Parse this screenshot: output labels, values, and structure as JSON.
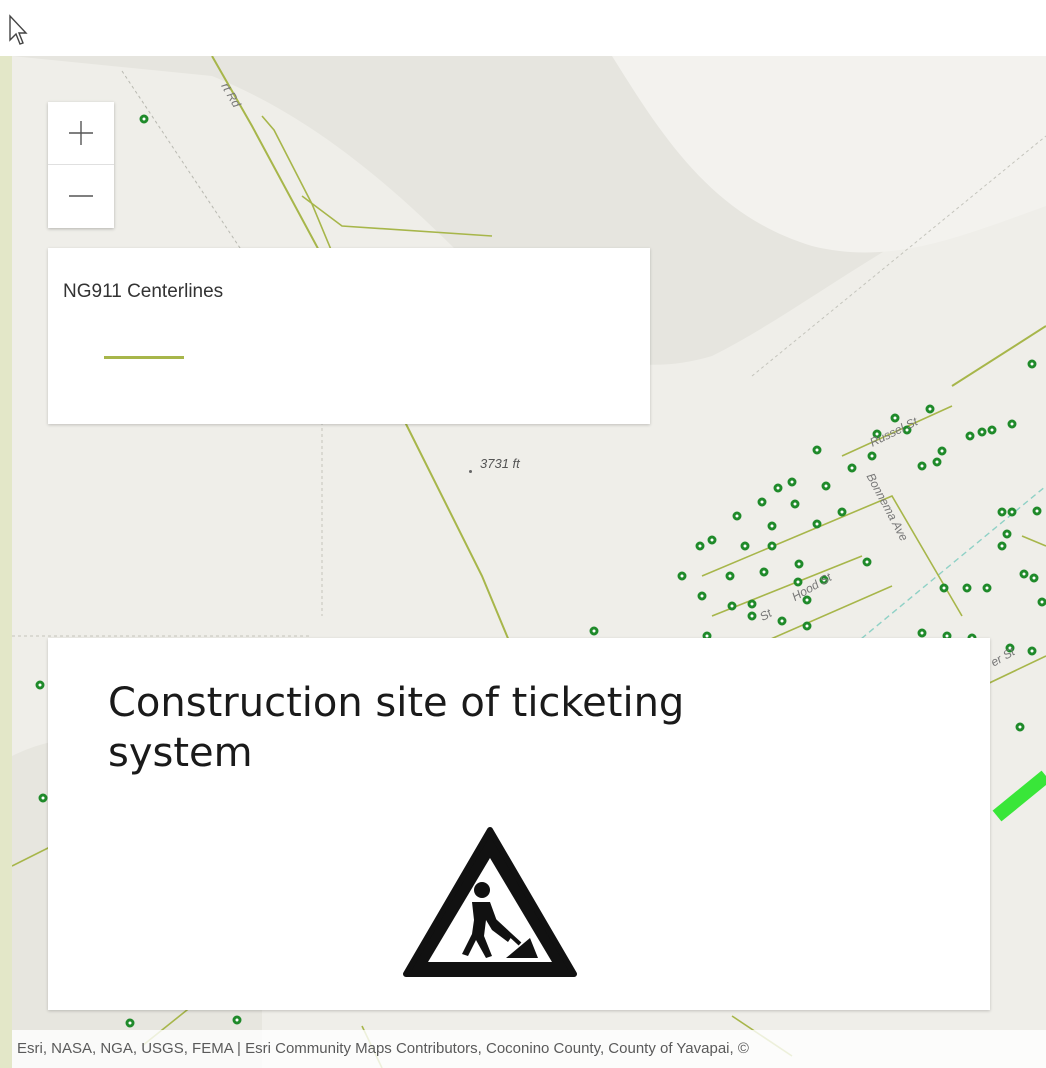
{
  "zoom": {
    "in_symbol": "+",
    "out_symbol": "—"
  },
  "legend": {
    "title": "NG911 Centerlines",
    "swatch_color": "#a7b64a"
  },
  "map": {
    "elevation_label": "3731 ft",
    "streets": [
      "Russel St",
      "Bonnema Ave",
      "Hood St",
      "St",
      "er St",
      "rt Rd"
    ]
  },
  "notice": {
    "text": "Construction site of ticketing system",
    "icon": "construction-worker-warning-icon"
  },
  "attribution": {
    "text": "Esri, NASA, NGA, USGS, FEMA | Esri Community Maps Contributors, Coconino County, County of Yavapai, ©"
  },
  "colors": {
    "road": "#a7b64a",
    "address_point": "#1f8a2a",
    "highlight_road": "#39e639",
    "accent_frame": "#e3e7c8"
  }
}
